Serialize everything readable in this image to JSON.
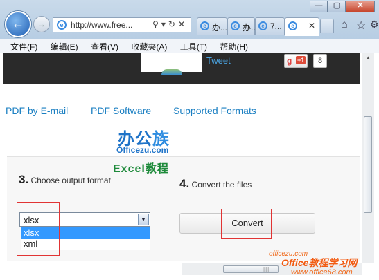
{
  "browser": {
    "address_url": "http://www.free...",
    "address_tools": "⚲▾↻✕",
    "back_glyph": "←",
    "forward_glyph": "→",
    "tabs": [
      {
        "label": "办..."
      },
      {
        "label": "办..."
      },
      {
        "label": "7..."
      },
      {
        "label": ""
      }
    ],
    "tab_close": "✕",
    "win_min": "—",
    "win_max": "▢",
    "win_close": "✕",
    "home_glyph": "⌂",
    "fav_glyph": "☆",
    "icons": [
      "back-arrow-icon",
      "forward-arrow-icon",
      "ie-logo-icon",
      "search-icon",
      "refresh-icon",
      "stop-icon",
      "home-icon",
      "star-icon",
      "gear-icon"
    ]
  },
  "menubar": {
    "items": [
      "文件(F)",
      "编辑(E)",
      "查看(V)",
      "收藏夹(A)",
      "工具(T)",
      "帮助(H)"
    ]
  },
  "header": {
    "tweet": "Tweet",
    "gplus_g": "g",
    "gplus_label": "+1",
    "gplus_count": "8"
  },
  "nav": {
    "links": [
      "PDF by E-mail",
      "PDF Software",
      "Supported Formats"
    ]
  },
  "logo": {
    "line1": "办公",
    "line1b": "族",
    "line2": "Officezu.com",
    "line3": "Excel教程"
  },
  "converter": {
    "step3_number": "3.",
    "step3_label": "Choose output format",
    "step4_number": "4.",
    "step4_label": "Convert the files",
    "selected_format": "xlsx",
    "dropdown_arrow": "▼",
    "options": [
      "xlsx",
      "xml"
    ],
    "convert_button": "Convert"
  },
  "watermark": {
    "small": "officezu.com",
    "title": "Office教程学习网",
    "url": "www.office68.com"
  },
  "colors": {
    "link": "#1a7fc2",
    "highlight": "#e13434",
    "selected_option": "#3399ff",
    "header_band": "#2a2a2a"
  }
}
